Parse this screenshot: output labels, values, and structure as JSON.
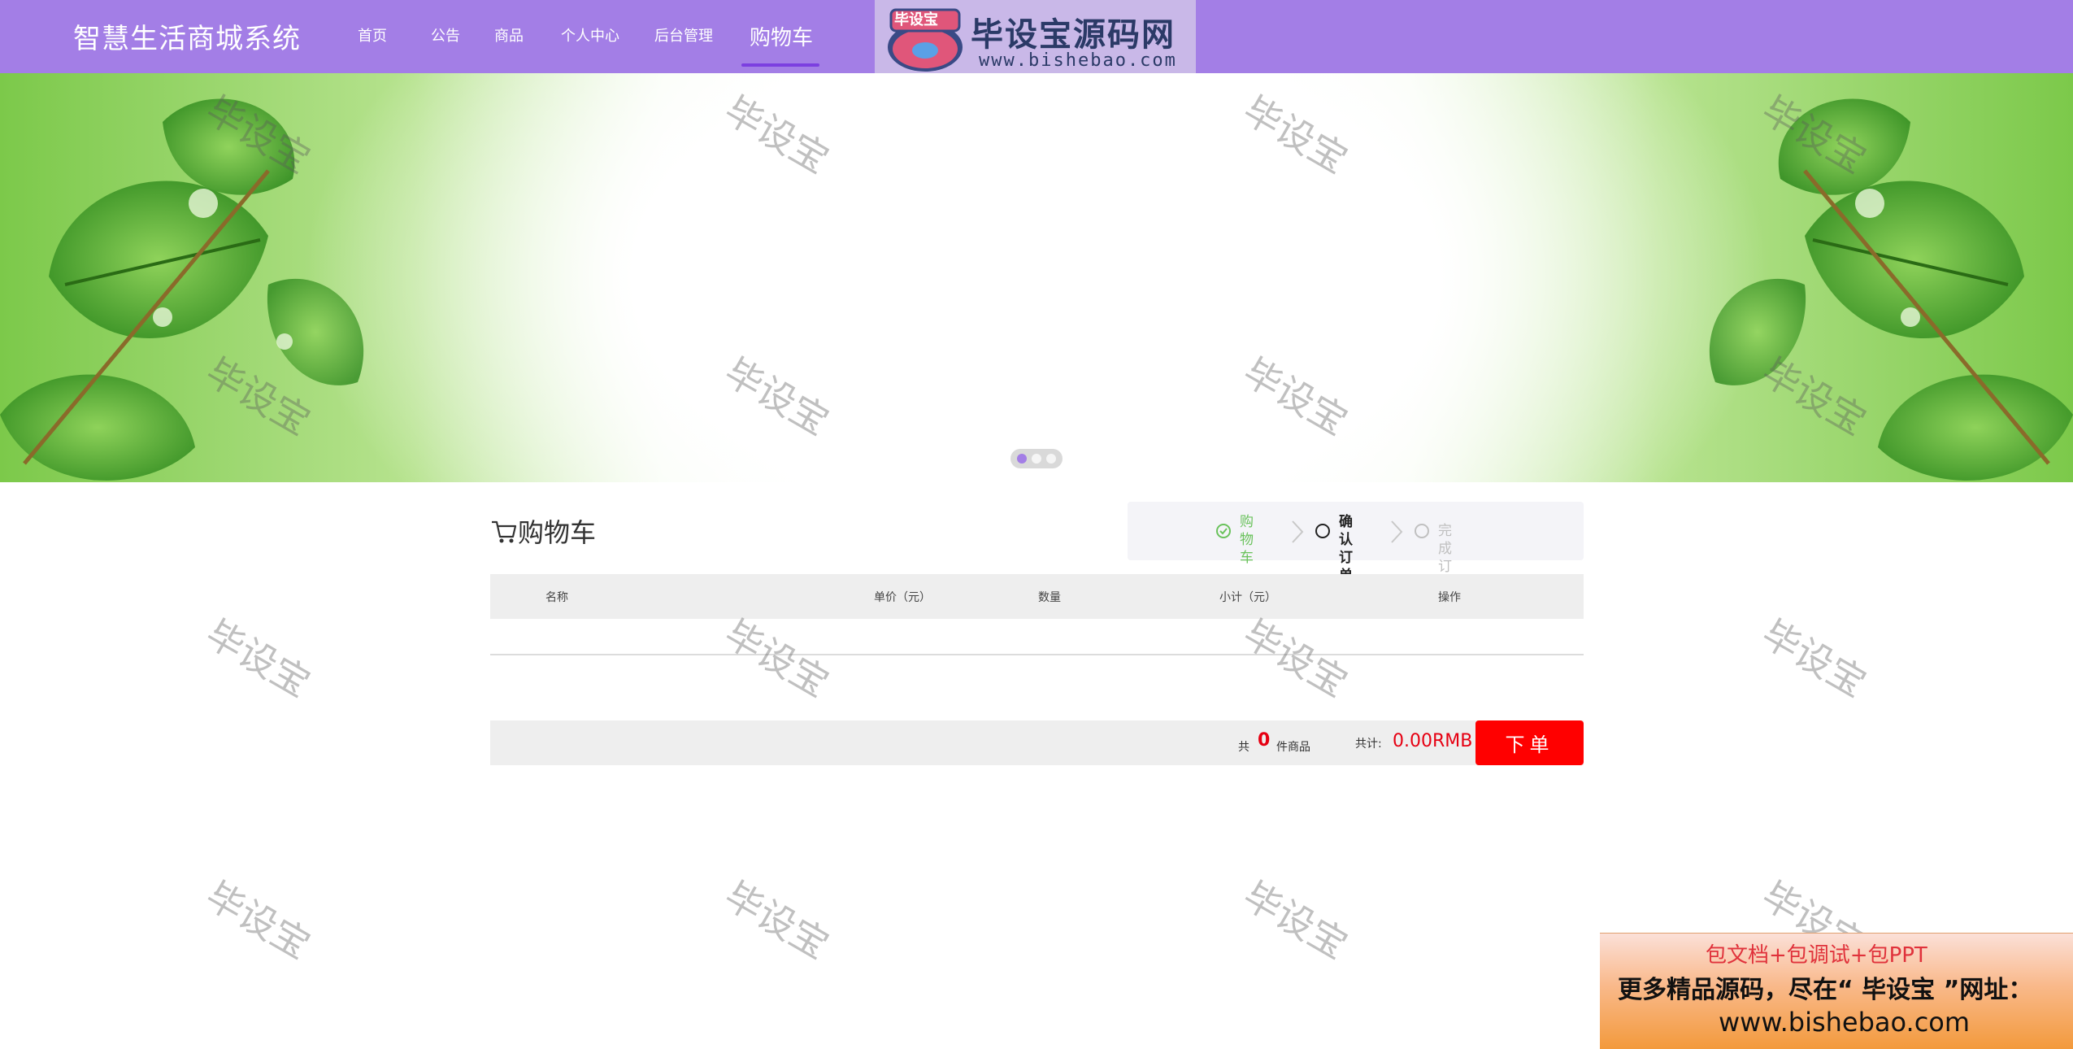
{
  "header": {
    "site_title": "智慧生活商城系统",
    "nav": [
      "首页",
      "公告",
      "商品",
      "个人中心",
      "后台管理",
      "购物车"
    ],
    "active_nav": "购物车",
    "logo_badge": {
      "emblem_text": "毕设宝",
      "title": "毕设宝源码网",
      "url": "www.bishebao.com"
    }
  },
  "banner": {
    "dots": 3,
    "active_dot": 0
  },
  "cart": {
    "title": "购物车",
    "steps": [
      {
        "label": "购物\n车",
        "state": "done"
      },
      {
        "label": "确认\n订单",
        "state": "current"
      },
      {
        "label": "完成订单",
        "state": "pending"
      }
    ],
    "columns": [
      "名称",
      "单价（元）",
      "数量",
      "小计（元）",
      "操作"
    ],
    "rows": [],
    "summary": {
      "prefix": "共",
      "count": "0",
      "suffix": "件商品",
      "total_label": "共计:",
      "total_value": "0.00RMB",
      "order_button": "下单"
    }
  },
  "watermark_text": "毕设宝",
  "promo": {
    "line1": "包文档+包调试+包PPT",
    "line2": "更多精品源码，尽在“ 毕设宝 ”网址：",
    "line3": "www.bishebao.com"
  },
  "colors": {
    "header_bg": "#a37ee6",
    "accent": "#7c3fe0",
    "price_red": "#e60012",
    "order_button": "#ff0000",
    "step_done": "#6ac25c"
  }
}
